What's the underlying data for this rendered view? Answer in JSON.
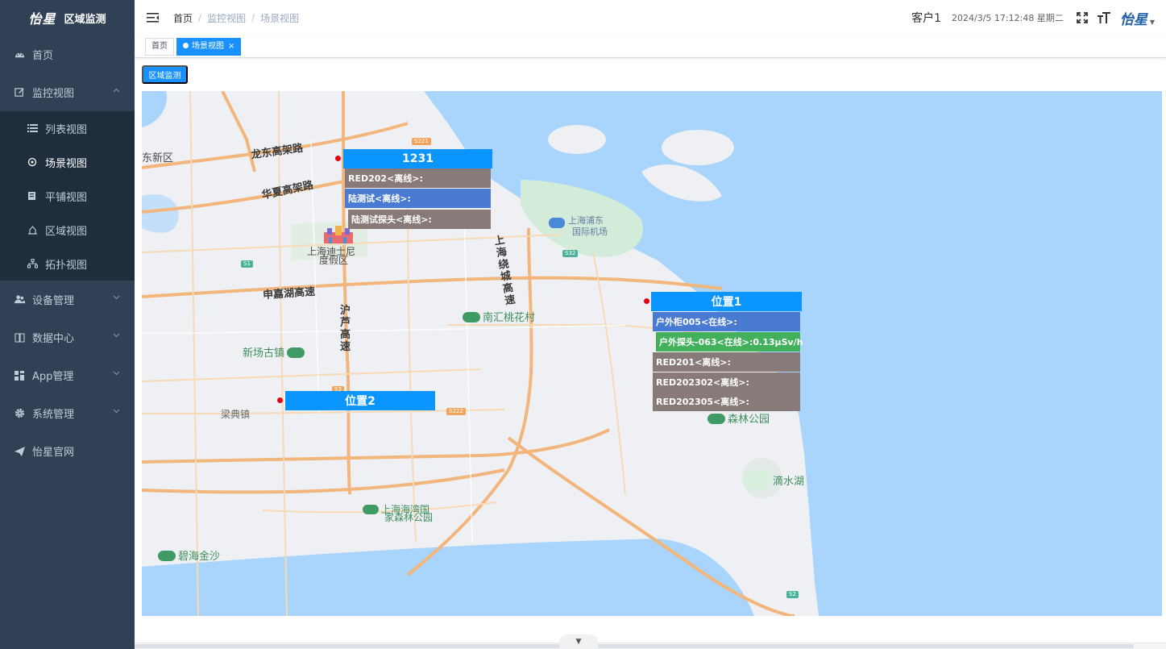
{
  "sidebar": {
    "logo_mark": "怡星",
    "logo_title": "区域监测",
    "items": [
      {
        "label": "首页",
        "icon": "dashboard-icon"
      },
      {
        "label": "监控视图",
        "icon": "edit-icon",
        "expanded": true,
        "children": [
          {
            "label": "列表视图",
            "icon": "list-icon"
          },
          {
            "label": "场景视图",
            "icon": "scene-icon",
            "active": true
          },
          {
            "label": "平铺视图",
            "icon": "tile-icon"
          },
          {
            "label": "区域视图",
            "icon": "region-icon"
          },
          {
            "label": "拓扑视图",
            "icon": "topology-icon"
          }
        ]
      },
      {
        "label": "设备管理",
        "icon": "people-icon"
      },
      {
        "label": "数据中心",
        "icon": "book-icon"
      },
      {
        "label": "App管理",
        "icon": "grid-icon"
      },
      {
        "label": "系统管理",
        "icon": "gear-icon"
      },
      {
        "label": "怡星官网",
        "icon": "send-icon"
      }
    ]
  },
  "header": {
    "breadcrumb": [
      "首页",
      "监控视图",
      "场景视图"
    ],
    "user": "客户1",
    "datetime": "2024/3/5 17:12:48 星期二",
    "brand": "怡星"
  },
  "tags": [
    {
      "label": "首页"
    },
    {
      "label": "场景视图",
      "active": true,
      "close": "×"
    }
  ],
  "toolbar": {
    "region_button": "区域监测"
  },
  "map": {
    "labels": {
      "xinqu": "东新区",
      "longdong": "龙东高架路",
      "huaxia": "华夏高架路",
      "disney1": "上海迪士尼",
      "disney2": "度假区",
      "shenjia": "申嘉湖高速",
      "hulu": "沪芦高速",
      "nanhui": "南汇桃花村",
      "xinchang": "新场古镇",
      "liangdian": "梁典镇",
      "pudong_airport1": "上海浦东",
      "pudong_airport2": "国际机场",
      "raocheng": "上海绕城高速",
      "forest": "森林公园",
      "dishui": "滴水湖",
      "haiwan1": "上海海湾国",
      "haiwan2": "家森林公园",
      "bihai": "碧海金沙",
      "s20": "S2",
      "s32": "S32",
      "s1": "S1",
      "s221": "S221",
      "s222": "S222",
      "s3": "S3"
    },
    "markers": [
      {
        "title": "1231",
        "devices": [
          {
            "text": "RED202<离线>:",
            "status": "offline"
          },
          {
            "text": "陆测试<离线>:",
            "status": "highlight"
          },
          {
            "text": "陆测试探头<离线>:",
            "status": "offline"
          }
        ]
      },
      {
        "title": "位置1",
        "devices": [
          {
            "text": "户外柜005<在线>:",
            "status": "highlight"
          },
          {
            "text": "户外探头-063<在线>:0.13μSv/h",
            "status": "online"
          },
          {
            "text": "RED201<离线>:",
            "status": "offline"
          },
          {
            "text": "RED202302<离线>:",
            "status": "offline"
          },
          {
            "text": "RED202305<离线>:",
            "status": "offline"
          }
        ]
      },
      {
        "title": "位置2",
        "devices": []
      }
    ]
  },
  "colors": {
    "sidebar_bg": "#304156",
    "submenu_bg": "#1f2d3d",
    "primary": "#1890ff",
    "panel_head": "#0a95ff",
    "offline": "#877a78",
    "highlight": "#4a7bd2",
    "online": "#43b05c",
    "water": "#a9d4fb",
    "road": "#f3b274"
  }
}
